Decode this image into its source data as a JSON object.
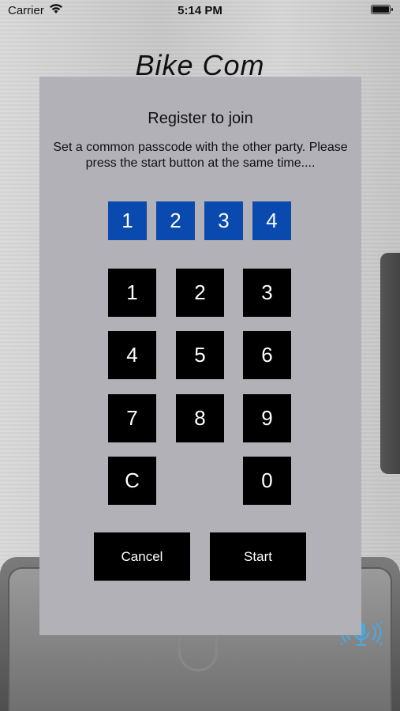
{
  "status_bar": {
    "carrier": "Carrier",
    "time": "5:14 PM"
  },
  "app": {
    "title": "Bike Com"
  },
  "dialog": {
    "title": "Register to join",
    "message": "Set a common passcode with the other party. Please press the start button at the same time....",
    "passcode": [
      "1",
      "2",
      "3",
      "4"
    ],
    "keypad": {
      "k1": "1",
      "k2": "2",
      "k3": "3",
      "k4": "4",
      "k5": "5",
      "k6": "6",
      "k7": "7",
      "k8": "8",
      "k9": "9",
      "clear": "C",
      "k0": "0"
    },
    "cancel_label": "Cancel",
    "start_label": "Start"
  },
  "colors": {
    "passcode_box": "#0a4aaf",
    "key_bg": "#000000",
    "dialog_bg": "#b1b1b7",
    "mic_icon": "#4aa8e0"
  },
  "icons": [
    "wifi-icon",
    "battery-icon",
    "microphone-icon"
  ]
}
